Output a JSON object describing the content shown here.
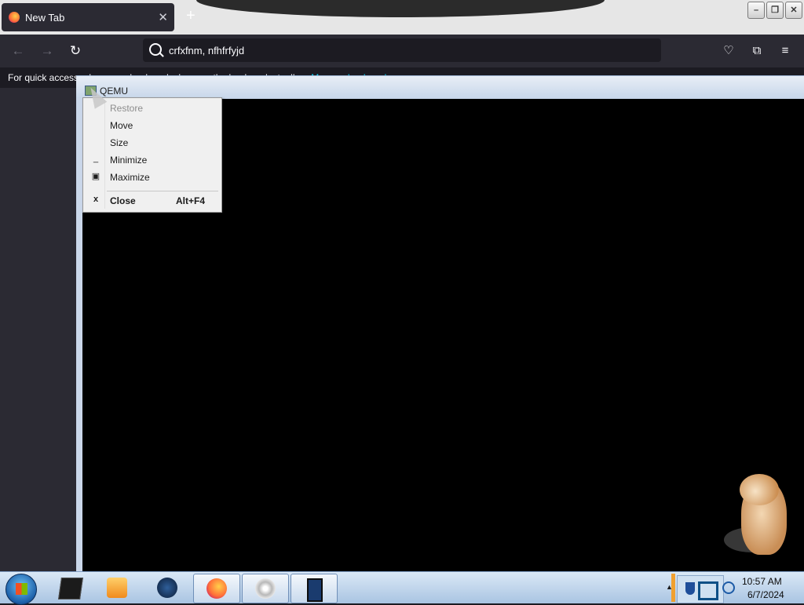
{
  "browser": {
    "tab": {
      "title": "New Tab",
      "close": "✕"
    },
    "new_tab": "+",
    "window_buttons": {
      "minimize": "–",
      "restore": "❐",
      "close": "✕"
    },
    "nav": {
      "back": "←",
      "forward": "→",
      "reload": "↻"
    },
    "url": {
      "value": "crfxfnm, nfhfrfyjd"
    },
    "toolbar_icons": {
      "pocket": "♡",
      "extensions": "⧉",
      "menu": "≡"
    },
    "bookmarks_bar": {
      "text": "For quick access, place your bookmarks here on the bookmarks toolbar.",
      "link": "Manage bookmarks…"
    }
  },
  "qemu": {
    "title": "QEMU",
    "system_menu": [
      {
        "label": "Restore",
        "icon": "",
        "shortcut": "",
        "disabled": true
      },
      {
        "label": "Move",
        "icon": "",
        "shortcut": ""
      },
      {
        "label": "Size",
        "icon": "",
        "shortcut": ""
      },
      {
        "label": "Minimize",
        "icon": "_",
        "shortcut": ""
      },
      {
        "label": "Maximize",
        "icon": "▣",
        "shortcut": ""
      },
      {
        "label": "Close",
        "icon": "x",
        "shortcut": "Alt+F4",
        "bold": true
      }
    ]
  },
  "taskbar": {
    "clock": {
      "time": "10:57 AM",
      "date": "6/7/2024"
    },
    "tray_up": "▲",
    "apps": [
      {
        "name": "terminal"
      },
      {
        "name": "media-player"
      },
      {
        "name": "steam"
      },
      {
        "name": "firefox"
      },
      {
        "name": "disc"
      },
      {
        "name": "qemu"
      }
    ]
  },
  "colors": {
    "accent": "#00ddff",
    "firefox_dark": "#2b2a33",
    "taskbar": "#b8d0ea"
  }
}
